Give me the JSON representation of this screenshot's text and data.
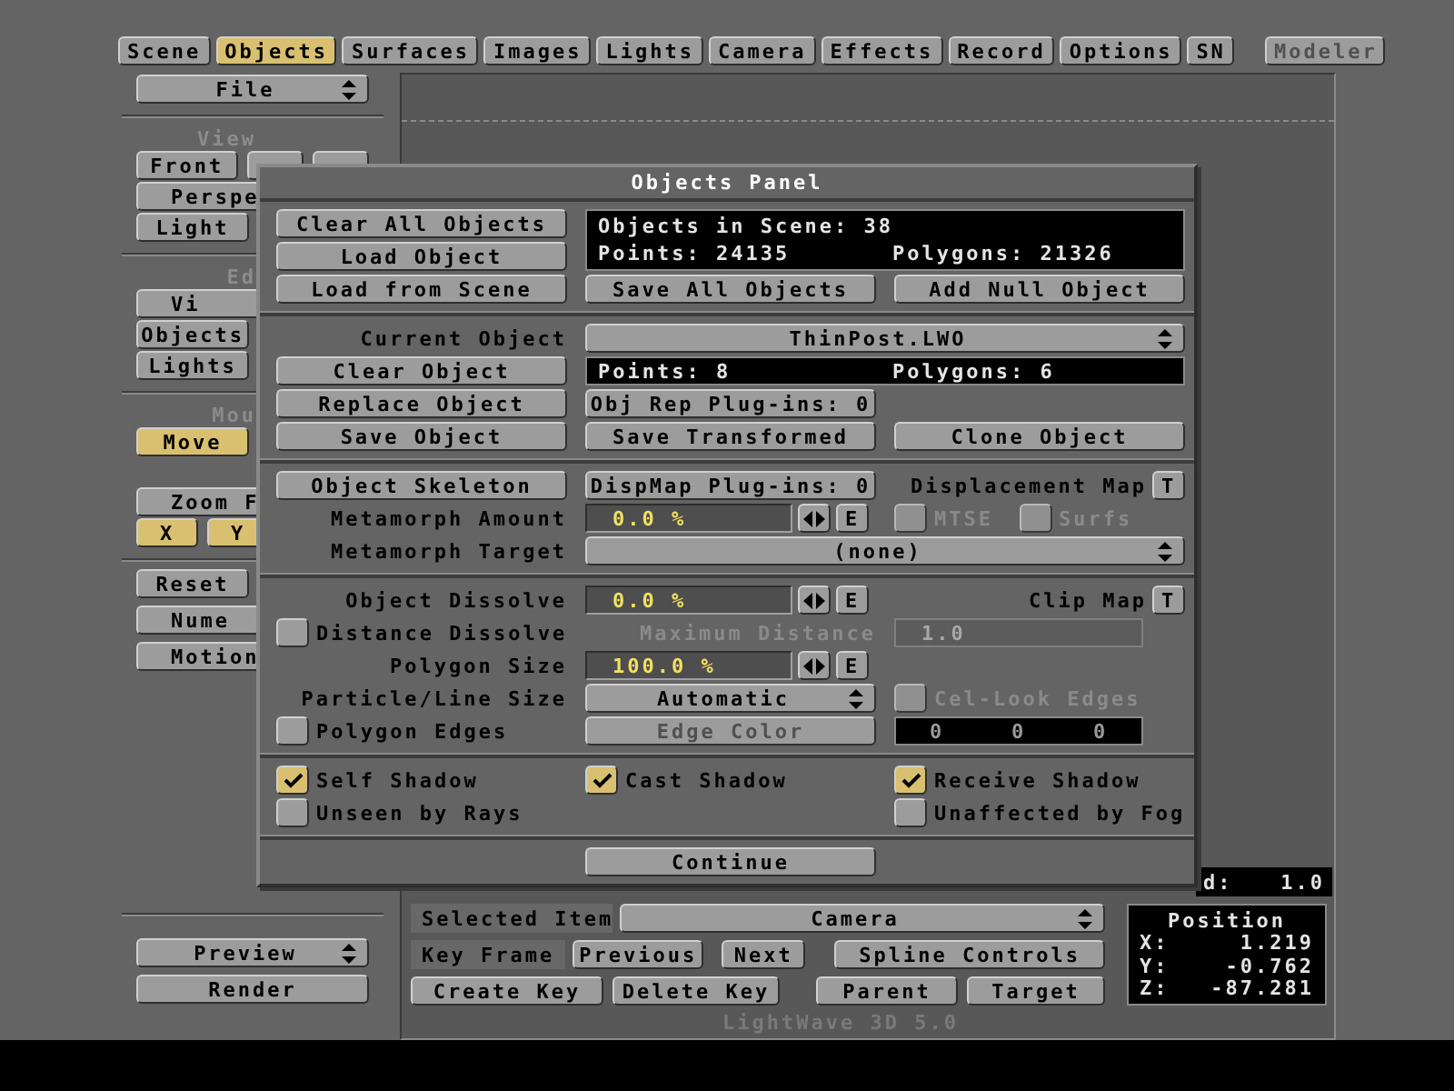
{
  "toolbar": {
    "tabs": [
      {
        "label": "Scene",
        "selected": false
      },
      {
        "label": "Objects",
        "selected": true
      },
      {
        "label": "Surfaces",
        "selected": false
      },
      {
        "label": "Images",
        "selected": false
      },
      {
        "label": "Lights",
        "selected": false
      },
      {
        "label": "Camera",
        "selected": false
      },
      {
        "label": "Effects",
        "selected": false
      },
      {
        "label": "Record",
        "selected": false
      },
      {
        "label": "Options",
        "selected": false
      },
      {
        "label": "SN",
        "selected": false
      }
    ],
    "modeler": {
      "label": "Modeler",
      "disabled": true
    }
  },
  "sidebar": {
    "file": "File",
    "sections": [
      {
        "heading": "View",
        "rows": [
          [
            {
              "label": "Front",
              "kind": "half",
              "selected": false
            },
            {
              "kind": "small",
              "selected": false
            },
            {
              "kind": "small",
              "selected": false
            }
          ],
          [
            {
              "label": "Perspe",
              "kind": "full",
              "selected": false
            }
          ],
          [
            {
              "label": "Light",
              "kind": "half",
              "selected": false
            }
          ]
        ]
      },
      {
        "heading": "Ed",
        "rows": [
          [
            {
              "label": "Vi",
              "kind": "full",
              "selected": false
            }
          ],
          [
            {
              "label": "Objects",
              "kind": "half",
              "selected": false
            }
          ],
          [
            {
              "label": "Lights",
              "kind": "half",
              "selected": false
            }
          ]
        ]
      },
      {
        "heading": "Mou",
        "rows": [
          [
            {
              "label": "Move",
              "kind": "half",
              "selected": true
            }
          ],
          [
            {
              "label": "Zoom F",
              "kind": "full",
              "selected": false
            }
          ],
          [
            {
              "label": "X",
              "kind": "small",
              "selected": true
            },
            {
              "label": "Y",
              "kind": "small",
              "selected": true
            }
          ]
        ]
      },
      {
        "rows": [
          [
            {
              "label": "Reset",
              "kind": "half",
              "selected": false
            }
          ],
          [
            {
              "label": "Nume",
              "kind": "full",
              "selected": false
            }
          ],
          [
            {
              "label": "Motion",
              "kind": "full",
              "selected": false
            }
          ]
        ]
      }
    ],
    "preview": "Preview",
    "render": "Render"
  },
  "panel": {
    "title": "Objects Panel",
    "scene_buttons": [
      "Clear All Objects",
      "Load Object",
      "Load from Scene"
    ],
    "scene_info": {
      "objects": "Objects in Scene: 38",
      "points": "Points: 24135",
      "polygons": "Polygons: 21326"
    },
    "save_all": "Save All Objects",
    "add_null": "Add Null Object",
    "current_object": {
      "label": "Current Object",
      "value": "ThinPost.LWO"
    },
    "clear_object": "Clear Object",
    "object_info": {
      "points": "Points: 8",
      "polygons": "Polygons: 6"
    },
    "replace_object": "Replace Object",
    "obj_rep_plugins": "Obj Rep Plug-ins: 0",
    "save_object": "Save Object",
    "save_transformed": "Save Transformed",
    "clone_object": "Clone Object",
    "object_skeleton": "Object Skeleton",
    "dispmap_plugins": "DispMap Plug-ins: 0",
    "displacement_map": {
      "label": "Displacement Map",
      "button": "T"
    },
    "metamorph_amount": {
      "label": "Metamorph Amount",
      "value": "0.0 %",
      "envelope": "E"
    },
    "mtse": {
      "label": "MTSE",
      "checked": false,
      "disabled": true
    },
    "surfs": {
      "label": "Surfs",
      "checked": false,
      "disabled": true
    },
    "metamorph_target": {
      "label": "Metamorph Target",
      "value": "(none)"
    },
    "object_dissolve": {
      "label": "Object Dissolve",
      "value": "0.0 %",
      "envelope": "E"
    },
    "clip_map": {
      "label": "Clip Map",
      "button": "T"
    },
    "distance_dissolve": {
      "label": "Distance Dissolve",
      "checked": false
    },
    "maximum_distance": {
      "label": "Maximum Distance",
      "value": "1.0",
      "disabled": true
    },
    "polygon_size": {
      "label": "Polygon Size",
      "value": "100.0 %",
      "envelope": "E"
    },
    "particle_line_size": {
      "label": "Particle/Line Size",
      "value": "Automatic"
    },
    "cel_look_edges": {
      "label": "Cel-Look Edges",
      "checked": false,
      "disabled": true
    },
    "polygon_edges": {
      "label": "Polygon Edges",
      "checked": false
    },
    "edge_color": {
      "label": "Edge Color",
      "disabled": true,
      "values": [
        "0",
        "0",
        "0"
      ]
    },
    "shadow_options": [
      {
        "label": "Self Shadow",
        "checked": true
      },
      {
        "label": "Cast Shadow",
        "checked": true
      },
      {
        "label": "Receive Shadow",
        "checked": true
      }
    ],
    "render_options": [
      {
        "label": "Unseen by Rays",
        "checked": false
      },
      {
        "label": "Unaffected by Fog",
        "checked": false
      }
    ],
    "continue": "Continue"
  },
  "viewport": {
    "grid_label": "d:",
    "grid_value": "1.0",
    "selected_item": {
      "label": "Selected Item",
      "value": "Camera"
    },
    "key_frame": "Key Frame",
    "previous": "Previous",
    "next": "Next",
    "spline_controls": "Spline Controls",
    "create_key": "Create Key",
    "delete_key": "Delete Key",
    "parent": "Parent",
    "target": "Target",
    "position": {
      "title": "Position",
      "rows": [
        {
          "axis": "X:",
          "value": "1.219"
        },
        {
          "axis": "Y:",
          "value": "-0.762"
        },
        {
          "axis": "Z:",
          "value": "-87.281"
        }
      ]
    },
    "version": "LightWave 3D 5.0"
  }
}
